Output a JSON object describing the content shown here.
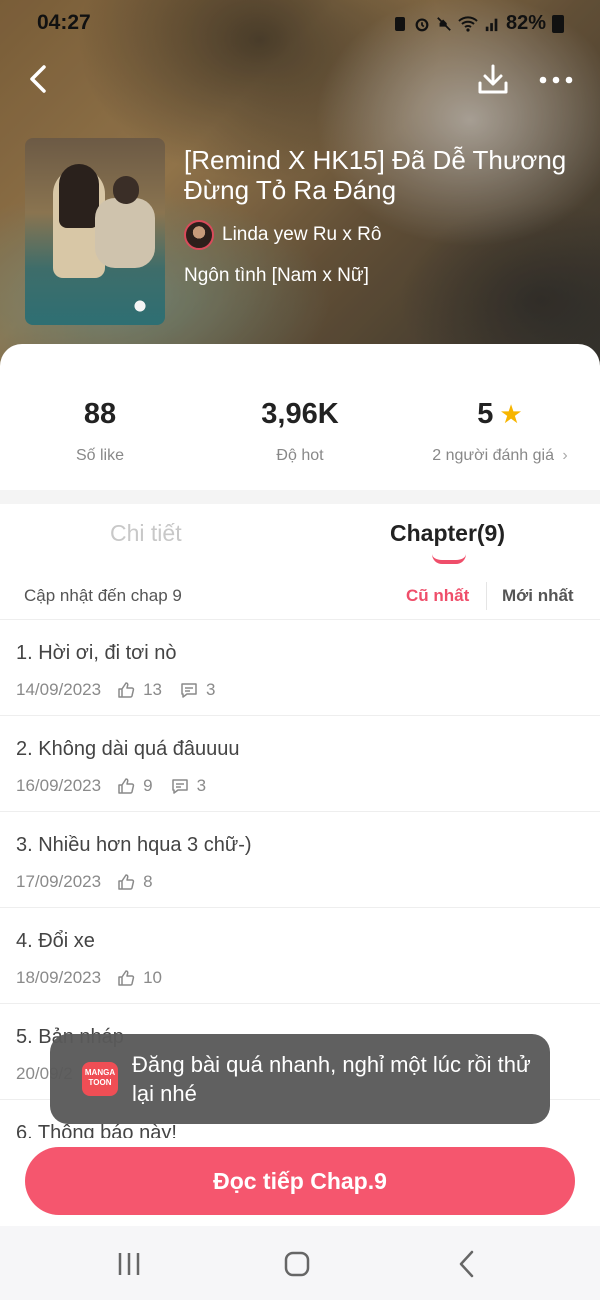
{
  "status_bar": {
    "time": "04:27",
    "battery": "82%"
  },
  "book": {
    "title": "[Remind X HK15] Đã Dễ Thương Đừng Tỏ Ra Đáng",
    "author": "Linda yew Ru x Rô",
    "genre": "Ngôn tình [Nam x Nữ]"
  },
  "stats": [
    {
      "value": "88",
      "label": "Số like"
    },
    {
      "value": "3,96K",
      "label": "Độ hot"
    },
    {
      "value": "5",
      "label": "2 người đánh giá"
    }
  ],
  "tabs": {
    "details": "Chi tiết",
    "chapters": "Chapter(9)"
  },
  "sort": {
    "update_text": "Cập nhật đến chap 9",
    "oldest": "Cũ nhất",
    "newest": "Mới nhất"
  },
  "chapters": [
    {
      "title": "1. Hời ơi, đi tơi nò",
      "date": "14/09/2023",
      "likes": "13",
      "comments": "3"
    },
    {
      "title": "2. Không dài quá đâuuuu",
      "date": "16/09/2023",
      "likes": "9",
      "comments": "3"
    },
    {
      "title": "3. Nhiều hơn hqua 3 chữ-)",
      "date": "17/09/2023",
      "likes": "8"
    },
    {
      "title": "4. Đổi xe",
      "date": "18/09/2023",
      "likes": "10"
    },
    {
      "title": "5. Bản nháp",
      "date": "20/09/2"
    },
    {
      "title": "6. Thông báo này!"
    }
  ],
  "toast": {
    "logo_text": "MANGA TOON",
    "message": "Đăng bài quá nhanh, nghỉ một lúc rồi thử lại nhé"
  },
  "cta": {
    "label": "Đọc tiếp Chap.9"
  },
  "colors": {
    "accent": "#ef4e6a",
    "cta": "#f5566e",
    "star": "#f7b500"
  },
  "icons": [
    "back-icon",
    "download-icon",
    "more-icon",
    "star-icon",
    "like-icon",
    "comment-icon",
    "recents-icon",
    "home-icon",
    "nav-back-icon"
  ]
}
